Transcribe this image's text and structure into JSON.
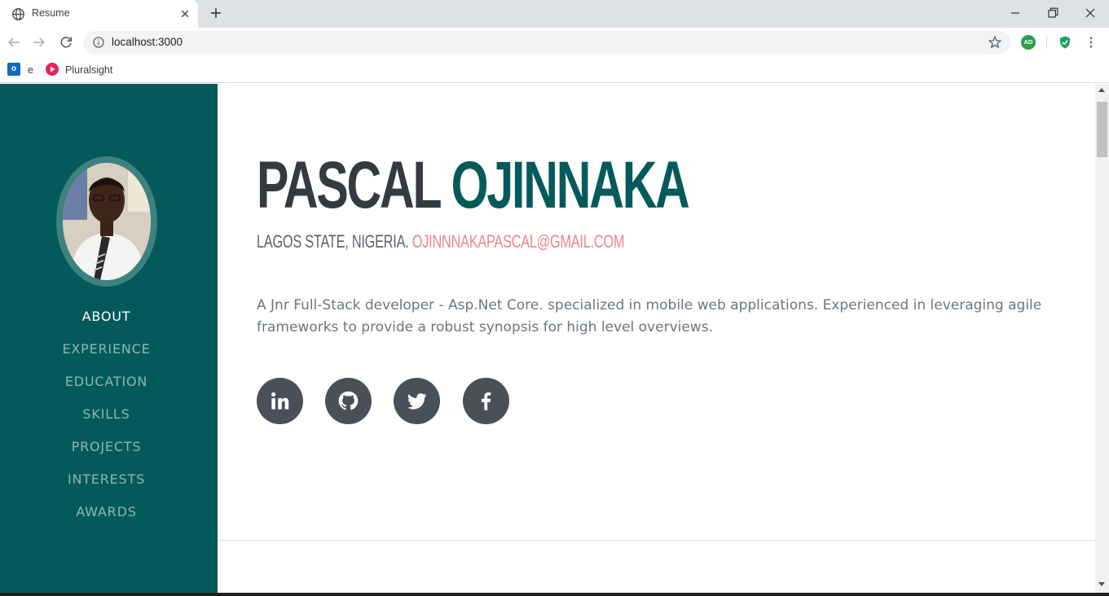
{
  "browser": {
    "tab_title": "Resume",
    "url": "localhost:3000",
    "extension_badge": "AD",
    "bookmarks": [
      {
        "label": "e",
        "icon": "outlook-icon"
      },
      {
        "label": "Pluralsight",
        "icon": "pluralsight-icon"
      }
    ]
  },
  "sidebar": {
    "bg_color": "#045a5a",
    "nav": [
      {
        "label": "ABOUT",
        "active": true
      },
      {
        "label": "EXPERIENCE"
      },
      {
        "label": "EDUCATION"
      },
      {
        "label": "SKILLS"
      },
      {
        "label": "PROJECTS"
      },
      {
        "label": "INTERESTS"
      },
      {
        "label": "AWARDS"
      }
    ]
  },
  "about": {
    "first_name": "PASCAL",
    "last_name": "OJINNAKA",
    "location": "LAGOS STATE, NIGERIA.",
    "email": "OJINNNAKAPASCAL@GMAIL.COM",
    "bio": "A Jnr Full-Stack developer - Asp.Net Core. specialized in mobile web applications. Experienced in leveraging agile frameworks to provide a robust synopsis for high level overviews.",
    "social": [
      "linkedin-icon",
      "github-icon",
      "twitter-icon",
      "facebook-icon"
    ],
    "accent_color": "#045a5a",
    "email_color": "#e9868b"
  }
}
